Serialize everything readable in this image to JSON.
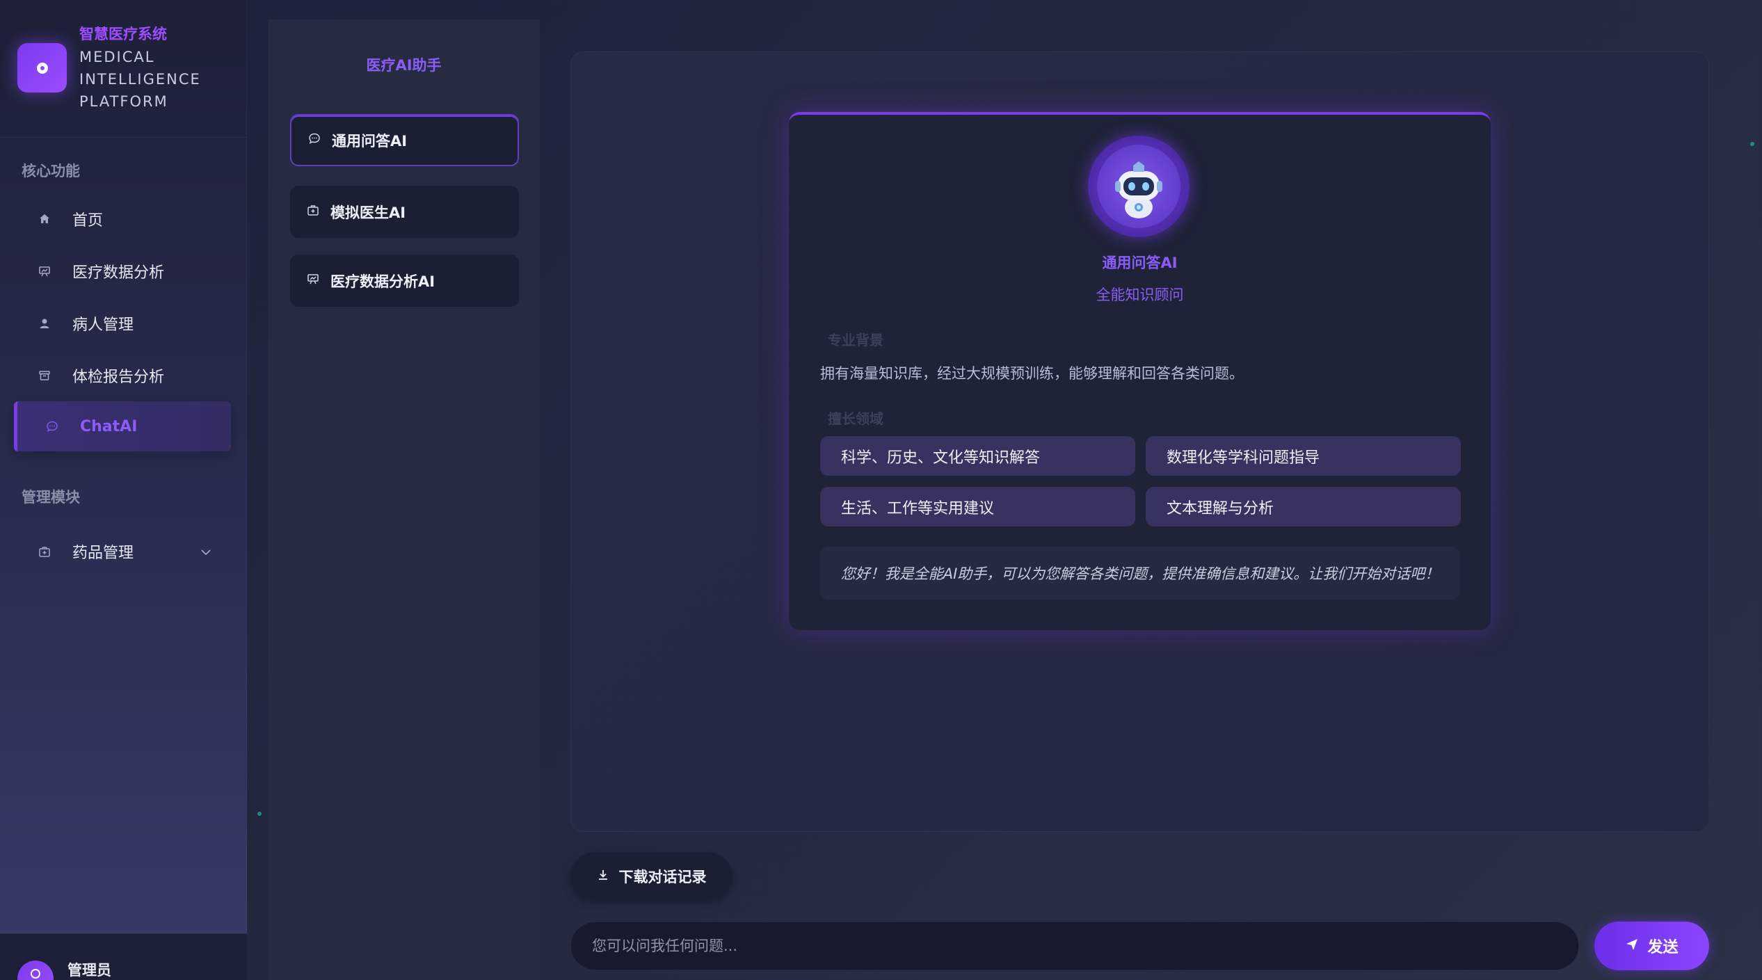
{
  "brand": {
    "name_cn": "智慧医疗系统",
    "name_en": "MEDICAL INTELLIGENCE PLATFORM"
  },
  "sidebar": {
    "section_core": "核心功能",
    "section_admin": "管理模块",
    "items": [
      {
        "label": "首页",
        "icon": "home-icon"
      },
      {
        "label": "医疗数据分析",
        "icon": "chart-icon"
      },
      {
        "label": "病人管理",
        "icon": "user-icon"
      },
      {
        "label": "体检报告分析",
        "icon": "report-icon"
      },
      {
        "label": "ChatAI",
        "icon": "chat-icon",
        "active": true
      },
      {
        "label": "药品管理",
        "icon": "medicine-icon",
        "expandable": true
      }
    ],
    "user_name": "管理员"
  },
  "ai_panel": {
    "title": "医疗AI助手",
    "items": [
      {
        "label": "通用问答AI",
        "icon": "chat-icon",
        "active": true
      },
      {
        "label": "模拟医生AI",
        "icon": "medical-kit-icon"
      },
      {
        "label": "医疗数据分析AI",
        "icon": "chart-icon"
      }
    ]
  },
  "profile": {
    "name": "通用问答AI",
    "subtitle": "全能知识顾问",
    "background_label": "专业背景",
    "background_text": "拥有海量知识库，经过大规模预训练，能够理解和回答各类问题。",
    "expertise_label": "擅长领域",
    "expertise": [
      "科学、历史、文化等知识解答",
      "数理化等学科问题指导",
      "生活、工作等实用建议",
      "文本理解与分析"
    ],
    "greeting": "您好！我是全能AI助手，可以为您解答各类问题，提供准确信息和建议。让我们开始对话吧！"
  },
  "controls": {
    "download_label": "下载对话记录",
    "input_placeholder": "您可以问我任何问题...",
    "send_label": "发送"
  },
  "colors": {
    "accent": "#7c3aed",
    "accent_text": "#8b5cf6",
    "background": "#23283f"
  }
}
